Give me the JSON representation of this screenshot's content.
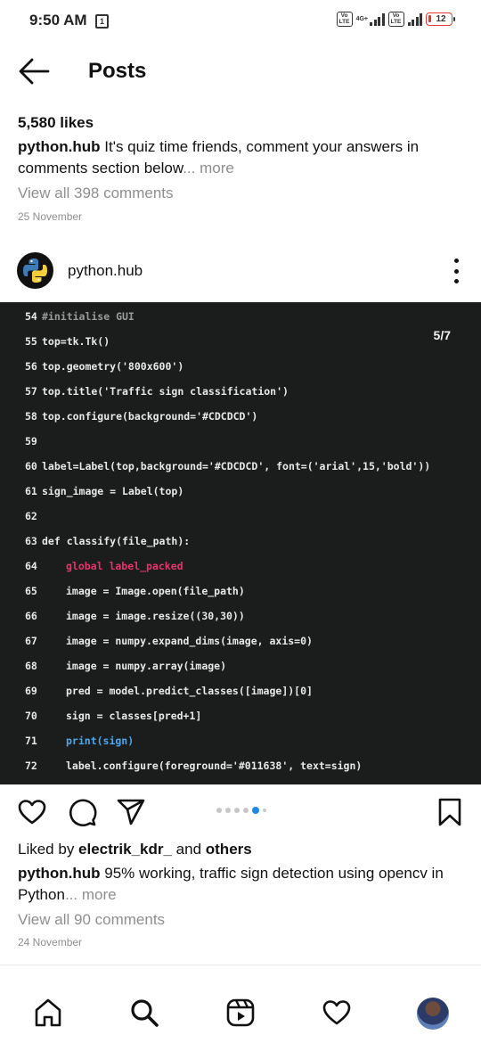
{
  "status_bar": {
    "time": "9:50 AM",
    "notification_icon": "msg-box-icon",
    "net_tag": "4G+",
    "volte_label_top": "Vo",
    "volte_label_bottom": "LTE",
    "battery": "12"
  },
  "header": {
    "title": "Posts",
    "back_icon": "arrow-left-icon"
  },
  "post_1": {
    "likes": "5,580 likes",
    "username": "python.hub",
    "caption": "It's quiz time friends, comment your answers in comments section below",
    "more": "... more",
    "view_comments": "View all 398 comments",
    "date": "25 November"
  },
  "post_2": {
    "username": "python.hub",
    "slide_counter": "5/7",
    "code_lines": [
      {
        "n": "54",
        "text": "#initialise GUI"
      },
      {
        "n": "55",
        "text": "top=tk.Tk()"
      },
      {
        "n": "56",
        "text": "top.geometry('800x600')"
      },
      {
        "n": "57",
        "text": "top.title('Traffic sign classification')"
      },
      {
        "n": "58",
        "text": "top.configure(background='#CDCDCD')"
      },
      {
        "n": "59",
        "text": ""
      },
      {
        "n": "60",
        "text": "label=Label(top,background='#CDCDCD', font=('arial',15,'bold'))"
      },
      {
        "n": "61",
        "text": "sign_image = Label(top)"
      },
      {
        "n": "62",
        "text": ""
      },
      {
        "n": "63",
        "text": "def classify(file_path):"
      },
      {
        "n": "64",
        "text": "global label_packed"
      },
      {
        "n": "65",
        "text": "image = Image.open(file_path)"
      },
      {
        "n": "66",
        "text": "image = image.resize((30,30))"
      },
      {
        "n": "67",
        "text": "image = numpy.expand_dims(image, axis=0)"
      },
      {
        "n": "68",
        "text": "image = numpy.array(image)"
      },
      {
        "n": "69",
        "text": "pred = model.predict_classes([image])[0]"
      },
      {
        "n": "70",
        "text": "sign = classes[pred+1]"
      },
      {
        "n": "71",
        "text": "print(sign)"
      },
      {
        "n": "72",
        "text": "label.configure(foreground='#011638', text=sign)"
      }
    ],
    "carousel": {
      "count": 6,
      "active_index": 4
    },
    "liked_by_prefix": "Liked by ",
    "liked_by_user": "electrik_kdr_",
    "liked_by_and": " and ",
    "liked_by_others": "others",
    "caption": "95% working, traffic sign detection using opencv in Python",
    "more": "... more",
    "view_comments": "View all 90 comments",
    "date": "24 November",
    "accent_color": "#1e88e5"
  },
  "bottom_nav": {
    "items": [
      "home-icon",
      "search-icon",
      "reels-icon",
      "heart-icon",
      "profile-avatar"
    ]
  }
}
